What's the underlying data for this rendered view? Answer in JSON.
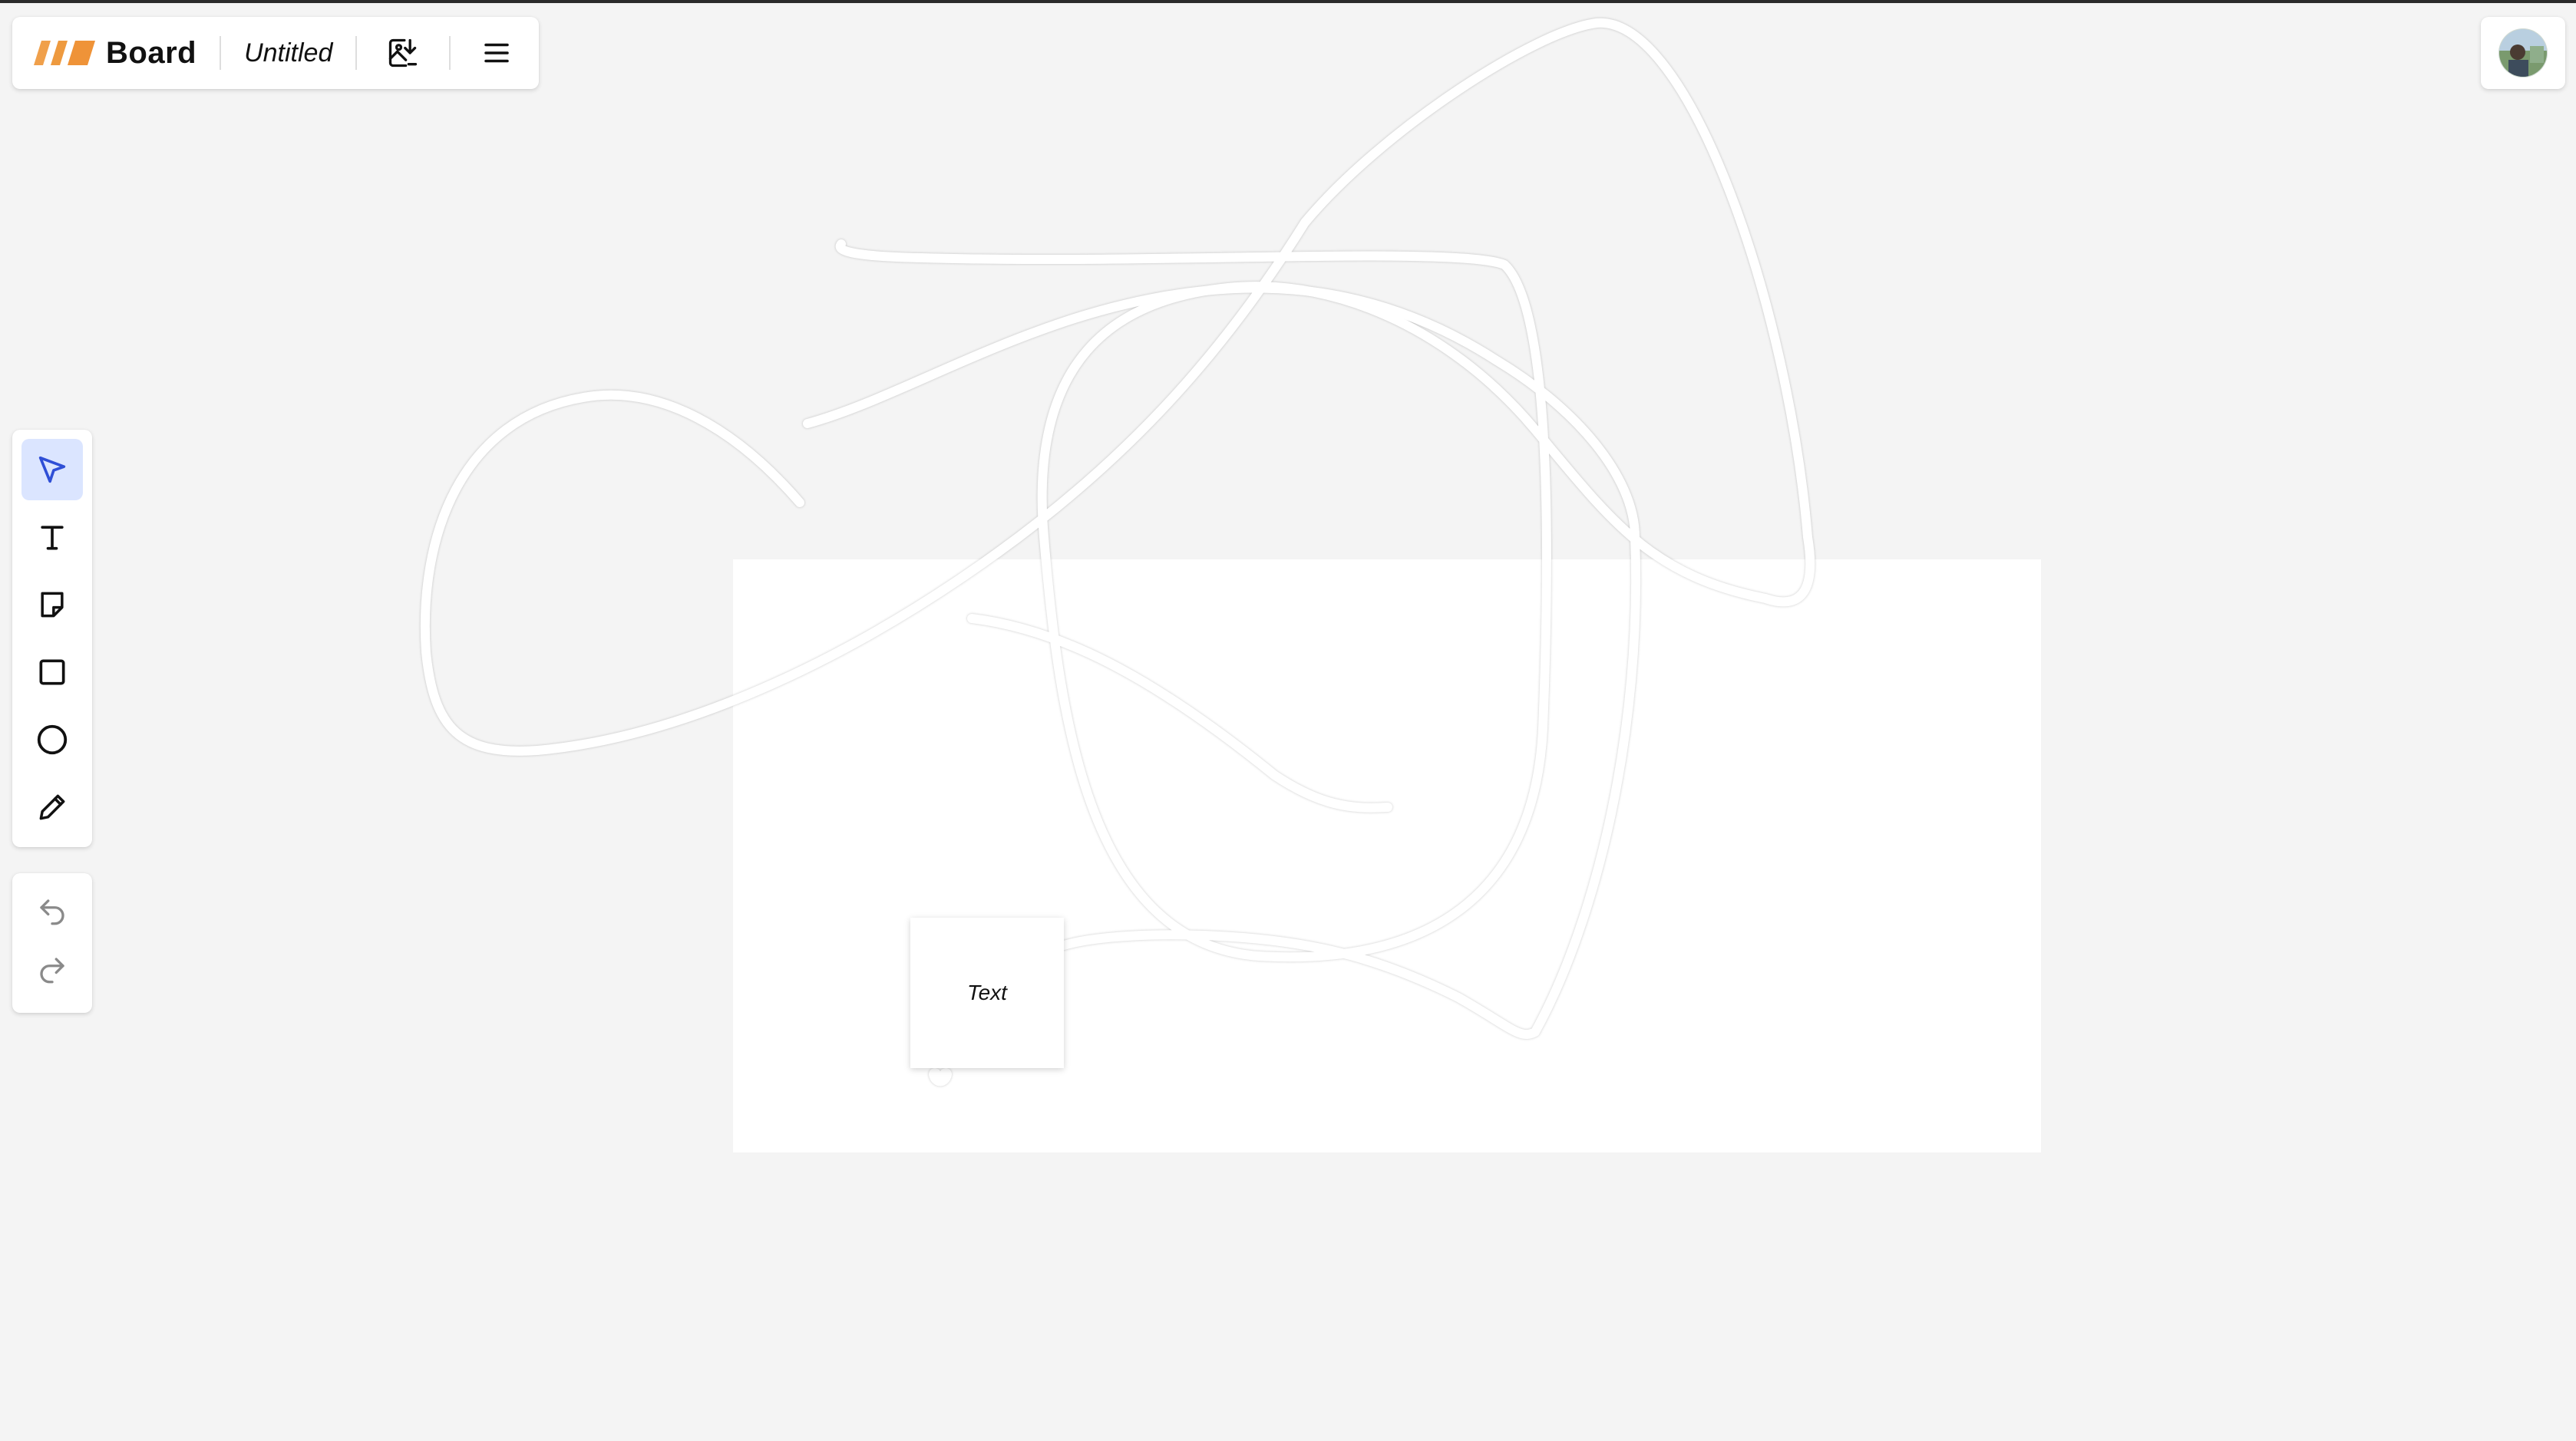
{
  "header": {
    "brand": "Board",
    "document_title": "Untitled",
    "icons": [
      "logo-stripes",
      "image-download-icon",
      "menu-icon"
    ],
    "logo_color": "#f0a04b"
  },
  "user": {
    "avatar_icon": "user-avatar"
  },
  "toolbar": {
    "tools": [
      {
        "name": "select",
        "icon": "cursor-arrow-icon",
        "active": true
      },
      {
        "name": "text",
        "icon": "text-icon",
        "active": false
      },
      {
        "name": "sticky-note",
        "icon": "sticky-note-icon",
        "active": false
      },
      {
        "name": "rectangle",
        "icon": "square-icon",
        "active": false
      },
      {
        "name": "ellipse",
        "icon": "circle-icon",
        "active": false
      },
      {
        "name": "pen",
        "icon": "pencil-icon",
        "active": false
      }
    ],
    "active_color": "#2f4fd6",
    "active_bg": "#dbe5ff"
  },
  "history": {
    "undo_icon": "undo-icon",
    "redo_icon": "redo-icon"
  },
  "board": {
    "background": "#f4f4f4",
    "note_text": "Text"
  }
}
